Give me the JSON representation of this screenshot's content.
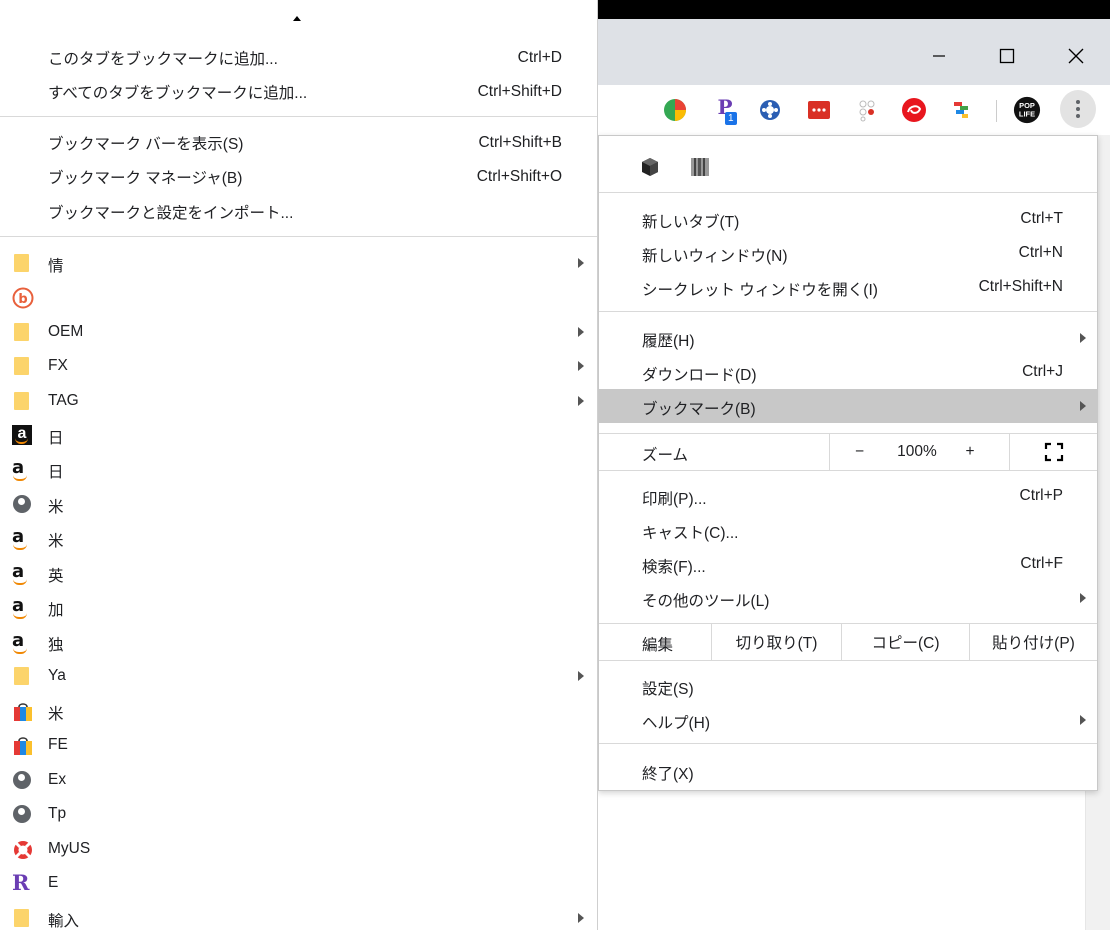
{
  "window": {
    "minimize_icon": "minimize-icon",
    "maximize_icon": "maximize-icon",
    "close_icon": "close-icon"
  },
  "toolbar": {
    "extensions": [
      {
        "name": "pie-chart-extension-icon"
      },
      {
        "name": "p-extension-icon",
        "badge": "1"
      },
      {
        "name": "blue-circle-extension-icon"
      },
      {
        "name": "red-dots-extension-icon"
      },
      {
        "name": "dots-extension-icon"
      },
      {
        "name": "red-swirl-extension-icon"
      },
      {
        "name": "colorful-extension-icon"
      },
      {
        "name": "pop-life-extension-icon",
        "label": "POP LIFE"
      }
    ]
  },
  "bookmarks_menu": {
    "actions": [
      {
        "label": "このタブをブックマークに追加...",
        "shortcut": "Ctrl+D"
      },
      {
        "label": "すべてのタブをブックマークに追加...",
        "shortcut": "Ctrl+Shift+D"
      },
      {
        "label": "ブックマーク バーを表示(S)",
        "shortcut": "Ctrl+Shift+B"
      },
      {
        "label": "ブックマーク マネージャ(B)",
        "shortcut": "Ctrl+Shift+O"
      },
      {
        "label": "ブックマークと設定をインポート...",
        "shortcut": ""
      }
    ],
    "items": [
      {
        "label": "情",
        "icon": "folder",
        "submenu": true
      },
      {
        "label": "",
        "icon": "b-circle",
        "submenu": false
      },
      {
        "label": "OEM",
        "icon": "folder",
        "submenu": true
      },
      {
        "label": "FX",
        "icon": "folder",
        "submenu": true
      },
      {
        "label": "TAG",
        "icon": "folder",
        "submenu": true
      },
      {
        "label": "日",
        "icon": "amazon-black",
        "submenu": false
      },
      {
        "label": "日",
        "icon": "amazon",
        "submenu": false
      },
      {
        "label": "米",
        "icon": "globe",
        "submenu": false
      },
      {
        "label": "米",
        "icon": "amazon",
        "submenu": false
      },
      {
        "label": "英",
        "icon": "amazon",
        "submenu": false
      },
      {
        "label": "加",
        "icon": "amazon",
        "submenu": false
      },
      {
        "label": "独",
        "icon": "amazon",
        "submenu": false
      },
      {
        "label": "Ya",
        "icon": "folder",
        "submenu": true
      },
      {
        "label": "米",
        "icon": "shopping-bag",
        "submenu": false
      },
      {
        "label": "FE",
        "icon": "shopping-bag",
        "submenu": false
      },
      {
        "label": "Ex",
        "icon": "globe",
        "submenu": false
      },
      {
        "label": "Tp",
        "icon": "globe",
        "submenu": false
      },
      {
        "label": "MyUS",
        "icon": "lifebuoy",
        "submenu": false
      },
      {
        "label": "E",
        "icon": "r-letter",
        "submenu": false
      },
      {
        "label": "輸入",
        "icon": "folder",
        "submenu": true
      }
    ]
  },
  "main_menu": {
    "group1": [
      {
        "label": "新しいタブ(T)",
        "shortcut": "Ctrl+T"
      },
      {
        "label": "新しいウィンドウ(N)",
        "shortcut": "Ctrl+N"
      },
      {
        "label": "シークレット ウィンドウを開く(I)",
        "shortcut": "Ctrl+Shift+N"
      }
    ],
    "group2": [
      {
        "label": "履歴(H)",
        "shortcut": "",
        "submenu": true
      },
      {
        "label": "ダウンロード(D)",
        "shortcut": "Ctrl+J",
        "submenu": false
      },
      {
        "label": "ブックマーク(B)",
        "shortcut": "",
        "submenu": true,
        "active": true
      }
    ],
    "zoom": {
      "label": "ズーム",
      "minus": "−",
      "value": "100%",
      "plus": "+"
    },
    "group3": [
      {
        "label": "印刷(P)...",
        "shortcut": "Ctrl+P"
      },
      {
        "label": "キャスト(C)...",
        "shortcut": ""
      },
      {
        "label": "検索(F)...",
        "shortcut": "Ctrl+F"
      },
      {
        "label": "その他のツール(L)",
        "shortcut": "",
        "submenu": true
      }
    ],
    "edit": {
      "label": "編集",
      "cut": "切り取り(T)",
      "copy": "コピー(C)",
      "paste": "貼り付け(P)"
    },
    "group4": [
      {
        "label": "設定(S)",
        "shortcut": ""
      },
      {
        "label": "ヘルプ(H)",
        "shortcut": "",
        "submenu": true
      }
    ],
    "exit": {
      "label": "終了(X)"
    }
  },
  "colors": {
    "highlight": "#c8c8c8",
    "folder": "#fcd46b",
    "chrome_frame": "#dee1e6"
  }
}
